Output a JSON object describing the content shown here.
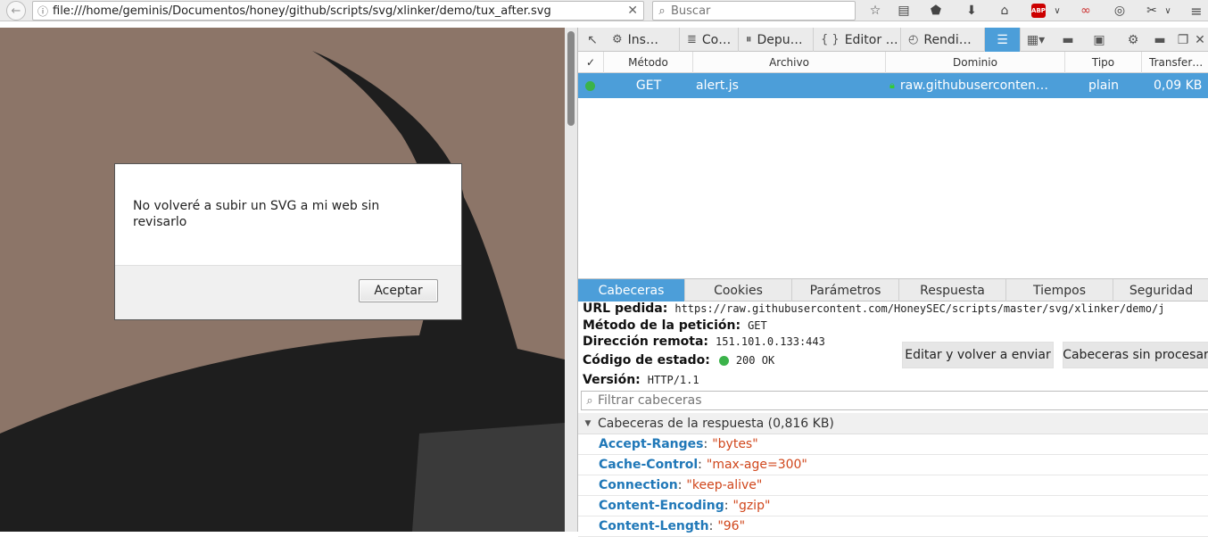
{
  "browser": {
    "url": "file:///home/geminis/Documentos/honey/github/scripts/svg/xlinker/demo/tux_after.svg",
    "search_placeholder": "Buscar",
    "abp_label": "ABP",
    "icons": [
      "back-icon",
      "info-icon",
      "clear-icon",
      "search-icon",
      "star-icon",
      "reading-list-icon",
      "pocket-icon",
      "download-icon",
      "home-icon",
      "adblock-icon",
      "chevron-down-icon",
      "lastpass-icon",
      "globe-icon",
      "screenshot-icon",
      "hamburger-menu-icon"
    ]
  },
  "alert": {
    "message": "No volveré a subir un SVG a mi web sin revisarlo",
    "ok_label": "Aceptar"
  },
  "devtools": {
    "tabs": [
      {
        "label": "Ins…",
        "icon": "inspector-icon"
      },
      {
        "label": "Co…",
        "icon": "console-icon"
      },
      {
        "label": "Depu…",
        "icon": "debugger-icon"
      },
      {
        "label": "Editor …",
        "icon": "style-editor-icon"
      },
      {
        "label": "Rendi…",
        "icon": "performance-icon"
      }
    ],
    "network": {
      "columns": [
        "✓",
        "Método",
        "Archivo",
        "Dominio",
        "Tipo",
        "Transfer…"
      ],
      "rows": [
        {
          "method": "GET",
          "file": "alert.js",
          "domain": "raw.githubuserconten…",
          "type": "plain",
          "size": "0,09 KB",
          "status_color": "#3bb34a"
        }
      ]
    },
    "detail_tabs": [
      "Cabeceras",
      "Cookies",
      "Parámetros",
      "Respuesta",
      "Tiempos",
      "Seguridad"
    ],
    "summary": {
      "url_label": "URL pedida:",
      "url_value": "https://raw.githubusercontent.com/HoneySEC/scripts/master/svg/xlinker/demo/j",
      "method_label": "Método de la petición:",
      "method_value": "GET",
      "remote_label": "Dirección remota:",
      "remote_value": "151.101.0.133:443",
      "status_label": "Código de estado:",
      "status_value": "200 OK",
      "version_label": "Versión:",
      "version_value": "HTTP/1.1"
    },
    "edit_resend_label": "Editar y volver a enviar",
    "raw_headers_label": "Cabeceras sin procesar",
    "filter_placeholder": "Filtrar cabeceras",
    "response_headers_title": "Cabeceras de la respuesta (0,816 KB)",
    "response_headers": [
      {
        "name": "Accept-Ranges",
        "value": "\"bytes\""
      },
      {
        "name": "Cache-Control",
        "value": "\"max-age=300\""
      },
      {
        "name": "Connection",
        "value": "\"keep-alive\""
      },
      {
        "name": "Content-Encoding",
        "value": "\"gzip\""
      },
      {
        "name": "Content-Length",
        "value": "\"96\""
      }
    ],
    "colors": {
      "accent": "#4c9ed9",
      "header_name": "#2078b8",
      "header_value": "#d0461b",
      "page_bg": "#8c7568",
      "tux": "#1e1e1e"
    }
  }
}
